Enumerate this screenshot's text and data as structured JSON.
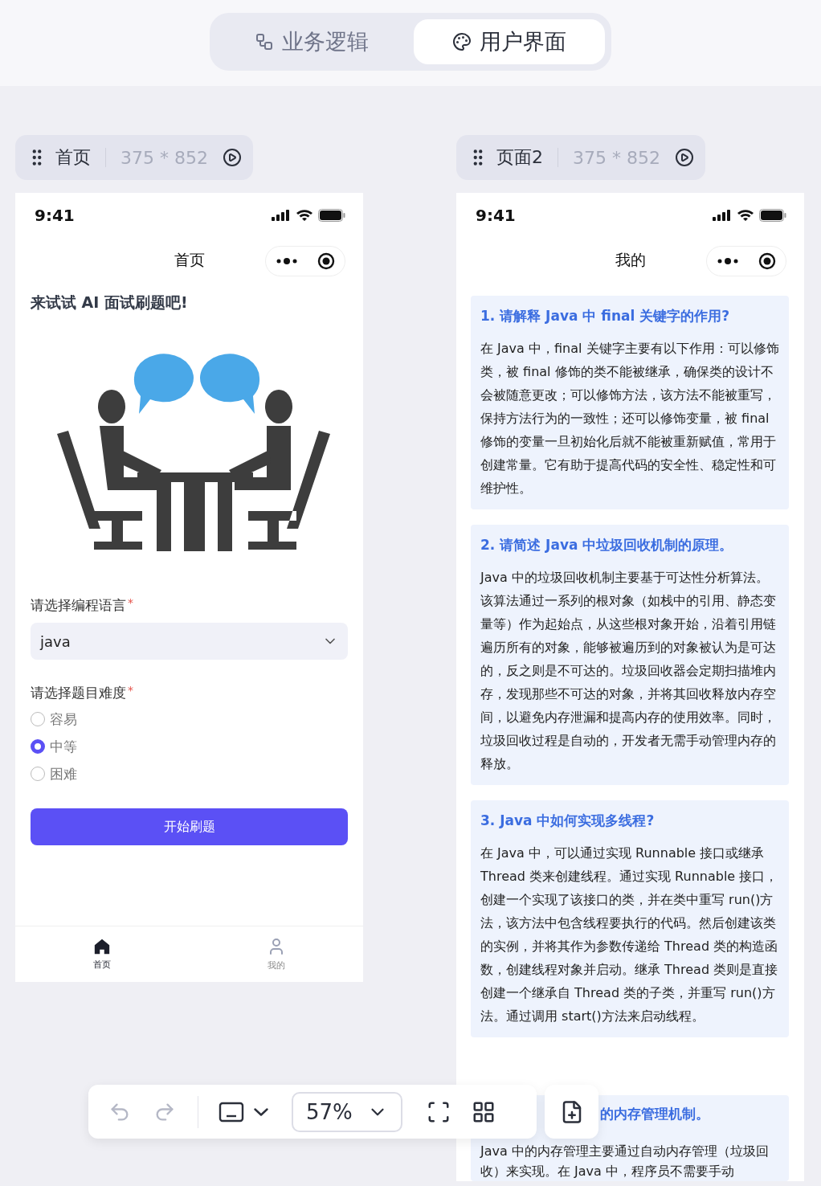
{
  "mode_tabs": [
    {
      "label": "业务逻辑",
      "selected": false
    },
    {
      "label": "用户界面",
      "selected": true
    }
  ],
  "pages": [
    {
      "name": "首页",
      "size": "375 * 852",
      "phone": {
        "time": "9:41",
        "nav_title": "首页",
        "kind": "form",
        "heading": "来试试 AI 面试刷题吧!",
        "language_label": "请选择编程语言",
        "language_required": "*",
        "language_value": "java",
        "difficulty_label": "请选择题目难度",
        "difficulty_required": "*",
        "difficulties": [
          {
            "label": "容易",
            "selected": false
          },
          {
            "label": "中等",
            "selected": true
          },
          {
            "label": "困难",
            "selected": false
          }
        ],
        "start_button": "开始刷题",
        "tab_bar": [
          {
            "label": "首页",
            "selected": true
          },
          {
            "label": "我的",
            "selected": false
          }
        ]
      }
    },
    {
      "name": "页面2",
      "size": "375 * 852",
      "phone": {
        "time": "9:41",
        "nav_title": "我的",
        "kind": "questions",
        "questions": [
          {
            "title": "1. 请解释 Java 中 final 关键字的作用?",
            "answer": "在 Java 中，final 关键字主要有以下作用：可以修饰类，被 final 修饰的类不能被继承，确保类的设计不会被随意更改；可以修饰方法，该方法不能被重写，保持方法行为的一致性；还可以修饰变量，被 final 修饰的变量一旦初始化后就不能被重新赋值，常用于创建常量。它有助于提高代码的安全性、稳定性和可维护性。"
          },
          {
            "title": "2. 请简述 Java 中垃圾回收机制的原理。",
            "answer": "Java 中的垃圾回收机制主要基于可达性分析算法。该算法通过一系列的根对象（如栈中的引用、静态变量等）作为起始点，从这些根对象开始，沿着引用链遍历所有的对象，能够被遍历到的对象被认为是可达的，反之则是不可达的。垃圾回收器会定期扫描堆内存，发现那些不可达的对象，并将其回收释放内存空间，以避免内存泄漏和提高内存的使用效率。同时，垃圾回收过程是自动的，开发者无需手动管理内存的释放。"
          },
          {
            "title": "3. Java 中如何实现多线程?",
            "answer": "在 Java 中，可以通过实现 Runnable 接口或继承 Thread 类来创建线程。通过实现 Runnable 接口，创建一个实现了该接口的类，并在类中重写 run()方法，该方法中包含线程要执行的代码。然后创建该类的实例，并将其作为参数传递给 Thread 类的构造函数，创建线程对象并启动。继承 Thread 类则是直接创建一个继承自 Thread 类的子类，并重写 run()方法。通过调用 start()方法来启动线程。"
          },
          {
            "title_parts": [
              "的内存管理机制。"
            ],
            "answer": "Java 中的内存管理主要通过自动内存管理（垃圾回收）来实现。在 Java 中，程序员不需要手动"
          }
        ]
      }
    }
  ],
  "toolbar": {
    "undo_disabled": true,
    "redo_disabled": true,
    "zoom": "57%"
  }
}
